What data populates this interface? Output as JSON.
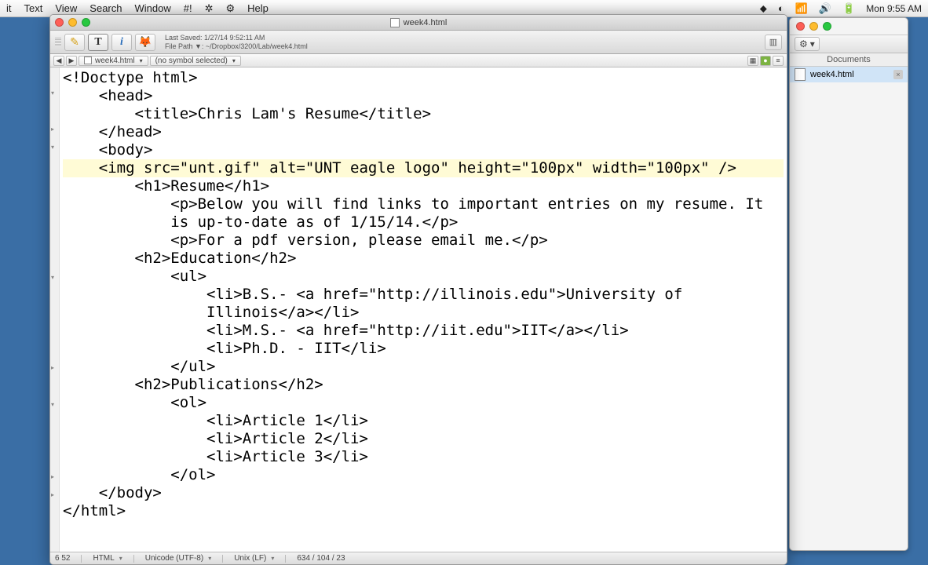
{
  "menubar": {
    "items": [
      "it",
      "Text",
      "View",
      "Search",
      "Window",
      "#!",
      "✲",
      "⚙",
      "Help"
    ],
    "right": {
      "icons": [
        "⬥",
        "◐",
        "📶",
        "🔊",
        "🔋"
      ],
      "clock": "Mon 9:55 AM"
    }
  },
  "backWindow": {
    "header": "Documents",
    "file": "week4.html"
  },
  "window": {
    "title": "week4.html",
    "lastSaved": "Last Saved: 1/27/14 9:52:11 AM",
    "filePath": "File Path ▼: ~/Dropbox/3200/Lab/week4.html"
  },
  "nav": {
    "file": "week4.html",
    "symbol": "(no symbol selected)"
  },
  "code": {
    "l1": "<!Doctype html>",
    "l2": "    <head>",
    "l3": "        <title>Chris Lam's Resume</title>",
    "l4": "    </head>",
    "l5": "    <body>",
    "l6": "    <img src=\"unt.gif\" alt=\"UNT eagle logo\" height=\"100px\" width=\"100px\" />",
    "l7": "        <h1>Resume</h1>",
    "l8": "            <p>Below you will find links to important entries on my resume. It",
    "l8b": "            is up-to-date as of 1/15/14.</p>",
    "l9": "            <p>For a pdf version, please email me.</p>",
    "l10": "        <h2>Education</h2>",
    "l11": "            <ul>",
    "l12": "                <li>B.S.- <a href=\"http://illinois.edu\">University of",
    "l12b": "                Illinois</a></li>",
    "l13": "                <li>M.S.- <a href=\"http://iit.edu\">IIT</a></li>",
    "l14": "                <li>Ph.D. - IIT</li>",
    "l15": "            </ul>",
    "l16": "        <h2>Publications</h2>",
    "l17": "            <ol>",
    "l18": "                <li>Article 1</li>",
    "l19": "                <li>Article 2</li>",
    "l20": "                <li>Article 3</li>",
    "l21": "            </ol>",
    "l22": "    </body>",
    "l23": "</html>"
  },
  "status": {
    "lineCol": "6   52",
    "lang": "HTML",
    "encoding": "Unicode (UTF-8)",
    "lineEnding": "Unix (LF)",
    "counts": "634 / 104 / 23"
  }
}
